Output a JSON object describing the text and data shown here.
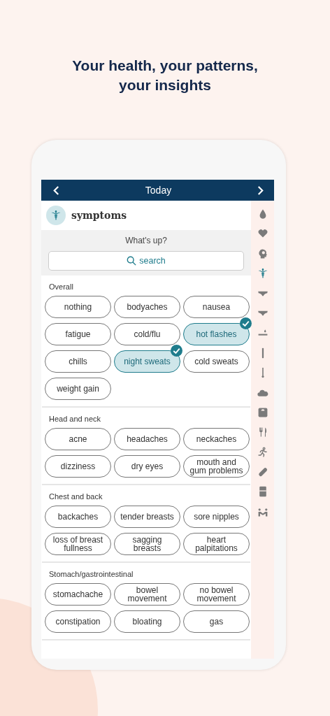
{
  "headline_lines": [
    "Your health, your patterns,",
    "your insights"
  ],
  "nav": {
    "title": "Today"
  },
  "category": {
    "title": "symptoms"
  },
  "prompt": "What's up?",
  "search": {
    "placeholder": "search"
  },
  "sidebar": [
    {
      "kind": "drop",
      "selected": false
    },
    {
      "kind": "heart",
      "selected": false
    },
    {
      "kind": "head",
      "selected": false
    },
    {
      "kind": "caduceus",
      "selected": true
    },
    {
      "kind": "underwear",
      "selected": false
    },
    {
      "kind": "underwear",
      "selected": false
    },
    {
      "kind": "test",
      "selected": false
    },
    {
      "kind": "strip",
      "selected": false
    },
    {
      "kind": "thermometer",
      "selected": false
    },
    {
      "kind": "cloud",
      "selected": false
    },
    {
      "kind": "scale",
      "selected": false
    },
    {
      "kind": "utensils",
      "selected": false
    },
    {
      "kind": "runner",
      "selected": false
    },
    {
      "kind": "pill",
      "selected": false
    },
    {
      "kind": "notebook",
      "selected": false
    },
    {
      "kind": "people",
      "selected": false
    }
  ],
  "sections": [
    {
      "title": "Overall",
      "chips": [
        {
          "label": "nothing",
          "selected": false
        },
        {
          "label": "bodyaches",
          "selected": false
        },
        {
          "label": "nausea",
          "selected": false
        },
        {
          "label": "fatigue",
          "selected": false
        },
        {
          "label": "cold/flu",
          "selected": false
        },
        {
          "label": "hot flashes",
          "selected": true
        },
        {
          "label": "chills",
          "selected": false
        },
        {
          "label": "night sweats",
          "selected": true
        },
        {
          "label": "cold sweats",
          "selected": false
        },
        {
          "label": "weight gain",
          "selected": false
        }
      ]
    },
    {
      "title": "Head and neck",
      "chips": [
        {
          "label": "acne",
          "selected": false
        },
        {
          "label": "headaches",
          "selected": false
        },
        {
          "label": "neckaches",
          "selected": false
        },
        {
          "label": "dizziness",
          "selected": false
        },
        {
          "label": "dry eyes",
          "selected": false
        },
        {
          "label": "mouth and\ngum problems",
          "selected": false
        }
      ]
    },
    {
      "title": "Chest and back",
      "chips": [
        {
          "label": "backaches",
          "selected": false
        },
        {
          "label": "tender breasts",
          "selected": false
        },
        {
          "label": "sore nipples",
          "selected": false
        },
        {
          "label": "loss of breast\nfullness",
          "selected": false
        },
        {
          "label": "sagging\nbreasts",
          "selected": false
        },
        {
          "label": "heart\npalpitations",
          "selected": false
        }
      ]
    },
    {
      "title": "Stomach/gastrointestinal",
      "chips": [
        {
          "label": "stomachache",
          "selected": false
        },
        {
          "label": "bowel\nmovement",
          "selected": false
        },
        {
          "label": "no bowel\nmovement",
          "selected": false
        },
        {
          "label": "constipation",
          "selected": false
        },
        {
          "label": "bloating",
          "selected": false
        },
        {
          "label": "gas",
          "selected": false
        }
      ]
    }
  ]
}
